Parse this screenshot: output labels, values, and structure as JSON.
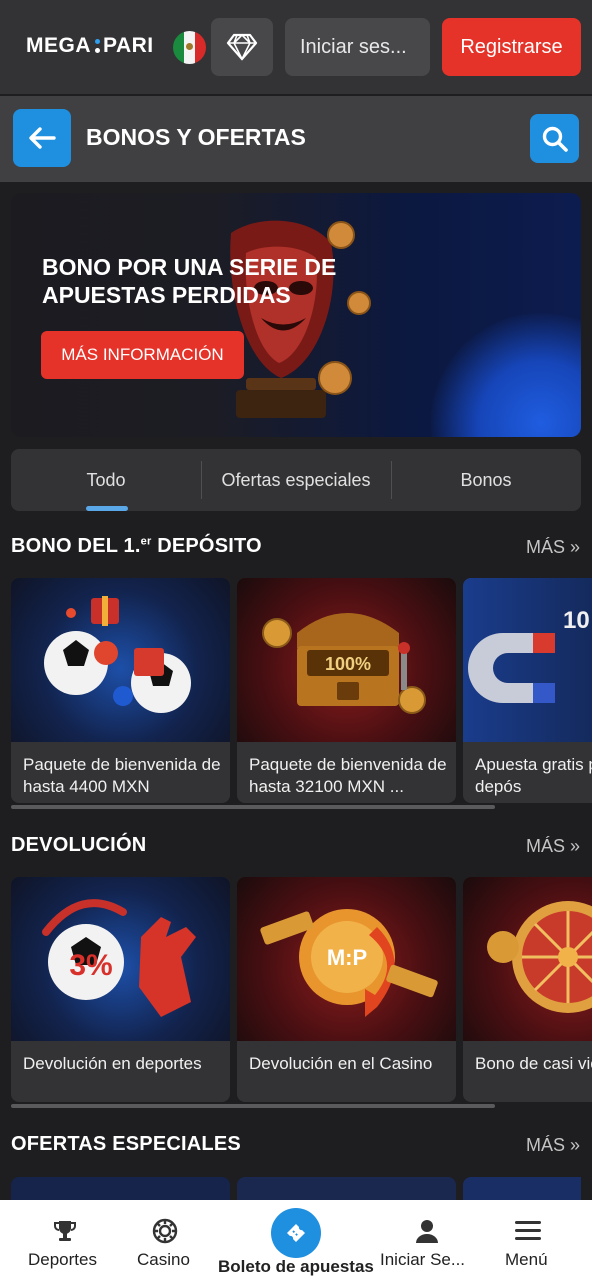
{
  "header": {
    "logo_left": "MEGA",
    "logo_right": "PARI",
    "login_label": "Iniciar ses...",
    "register_label": "Registrarse"
  },
  "page": {
    "title": "BONOS Y OFERTAS"
  },
  "hero": {
    "title": "BONO POR UNA SERIE DE APUESTAS PERDIDAS",
    "button": "MÁS INFORMACIÓN"
  },
  "tabs": [
    {
      "label": "Todo",
      "active": true
    },
    {
      "label": "Ofertas especiales",
      "active": false
    },
    {
      "label": "Bonos",
      "active": false
    }
  ],
  "sections": [
    {
      "title_main": "BONO DEL 1.",
      "title_sup": "er",
      "title_end": " DEPÓSITO",
      "more": "MÁS »",
      "cards": [
        {
          "label": "Paquete de bienvenida de hasta 4400 MXN"
        },
        {
          "label": "Paquete de bienvenida de hasta 32100 MXN ..."
        },
        {
          "label": "Apuesta gratis primer depós"
        }
      ]
    },
    {
      "title": "DEVOLUCIÓN",
      "more": "MÁS »",
      "cards": [
        {
          "label": "Devolución en deportes"
        },
        {
          "label": "Devolución en el Casino"
        },
        {
          "label": "Bono de casi viernes"
        }
      ]
    },
    {
      "title": "OFERTAS ESPECIALES",
      "more": "MÁS »"
    }
  ],
  "bottom_nav": [
    {
      "label": "Deportes",
      "icon": "trophy-icon"
    },
    {
      "label": "Casino",
      "icon": "poker-chip-icon"
    },
    {
      "label": "Boleto de apuestas",
      "icon": "ticket-icon"
    },
    {
      "label": "Iniciar Se...",
      "icon": "user-icon"
    },
    {
      "label": "Menú",
      "icon": "hamburger-icon"
    }
  ],
  "colors": {
    "accent_red": "#e5332a",
    "accent_blue": "#1f8fe0",
    "background": "#1e1e20"
  }
}
